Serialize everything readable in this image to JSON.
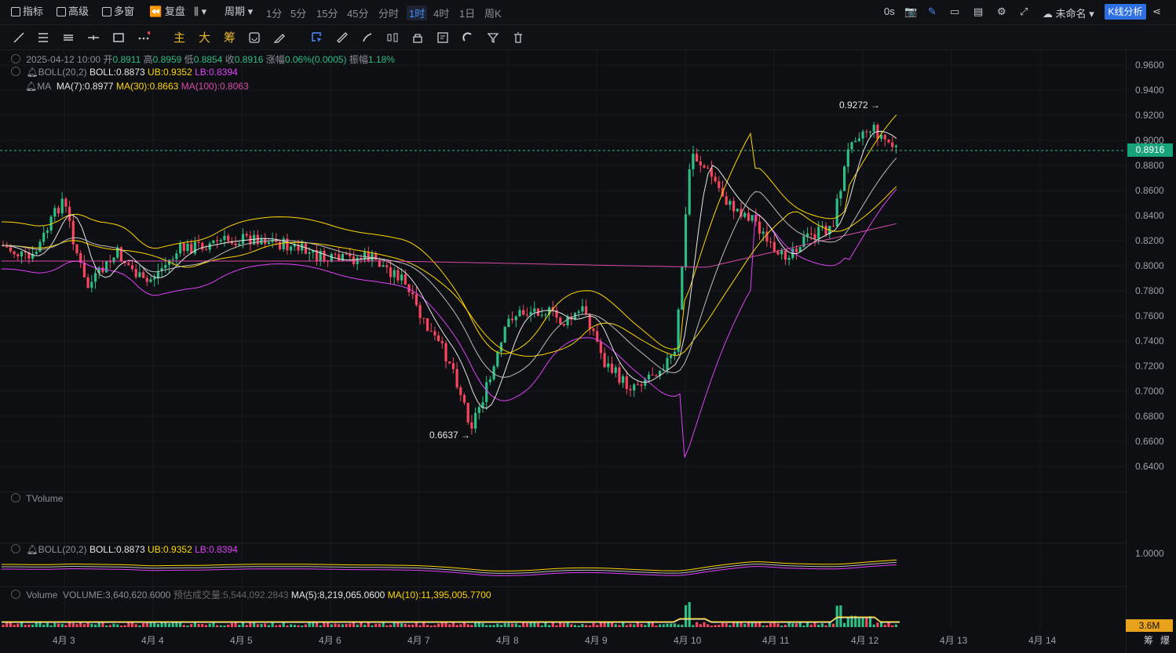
{
  "toolbar": {
    "indicators": "指标",
    "advanced": "高级",
    "multi_window": "多窗",
    "replay": "复盘",
    "period": "周期",
    "periods": [
      "1分",
      "5分",
      "15分",
      "45分",
      "分时",
      "1时",
      "4时",
      "1日",
      "周K"
    ],
    "active_period": "1时",
    "countdown": "0s",
    "layout_name": "未命名",
    "kline_analysis": "K线分析"
  },
  "drawing_tools": {
    "main": "主",
    "big": "大",
    "chips": "筹"
  },
  "legend": {
    "date": "2025-04-12 10:00",
    "open_label": "开",
    "open": "0.8911",
    "high_label": "高",
    "high": "0.8959",
    "low_label": "低",
    "low": "0.8854",
    "close_label": "收",
    "close": "0.8916",
    "change_label": "涨幅",
    "change": "0.06%(0.0005)",
    "amplitude_label": "振幅",
    "amplitude": "1.18%",
    "boll_name": "BOLL(20,2)",
    "boll": "BOLL:0.8873",
    "ub": "UB:0.9352",
    "lb": "LB:0.8394",
    "ma_name": "MA",
    "ma7": "MA(7):0.8977",
    "ma30": "MA(30):0.8663",
    "ma100": "MA(100):0.8063"
  },
  "annotations": {
    "high": "0.9272",
    "low": "0.6637",
    "current_price": "0.8916"
  },
  "y_axis": [
    "0.9600",
    "0.9400",
    "0.9200",
    "0.9000",
    "0.8800",
    "0.8600",
    "0.8400",
    "0.8200",
    "0.8000",
    "0.7800",
    "0.7600",
    "0.7400",
    "0.7200",
    "0.7000",
    "0.6800",
    "0.6600",
    "0.6400"
  ],
  "x_axis": [
    "4月 3",
    "4月 4",
    "4月 5",
    "4月 6",
    "4月 7",
    "4月 8",
    "4月 9",
    "4月 10",
    "4月 11",
    "4月 12",
    "4月 13",
    "4月 14"
  ],
  "tvolume": {
    "name": "TVolume"
  },
  "boll_pane": {
    "name": "BOLL(20,2)",
    "boll": "BOLL:0.8873",
    "ub": "UB:0.9352",
    "lb": "LB:0.8394",
    "axis": "1.0000"
  },
  "volume_pane": {
    "name": "Volume",
    "volume": "VOLUME:3,640,620.6000",
    "estimated": "预估成交量:5,544,092.2843",
    "ma5": "MA(5):8,219,065.0600",
    "ma10": "MA(10):11,395,005.7700",
    "axis": "3.6M"
  },
  "corner": {
    "chips": "筹",
    "liq": "爆"
  },
  "colors": {
    "up": "#2ebd85",
    "down": "#f6465d",
    "boll": "#ffffff",
    "ub": "#ffd600",
    "lb": "#e040fb",
    "ma7": "#e6e6e6",
    "ma30": "#ffd600",
    "ma100": "#d94aa8",
    "accent": "#2f6fe4"
  }
}
